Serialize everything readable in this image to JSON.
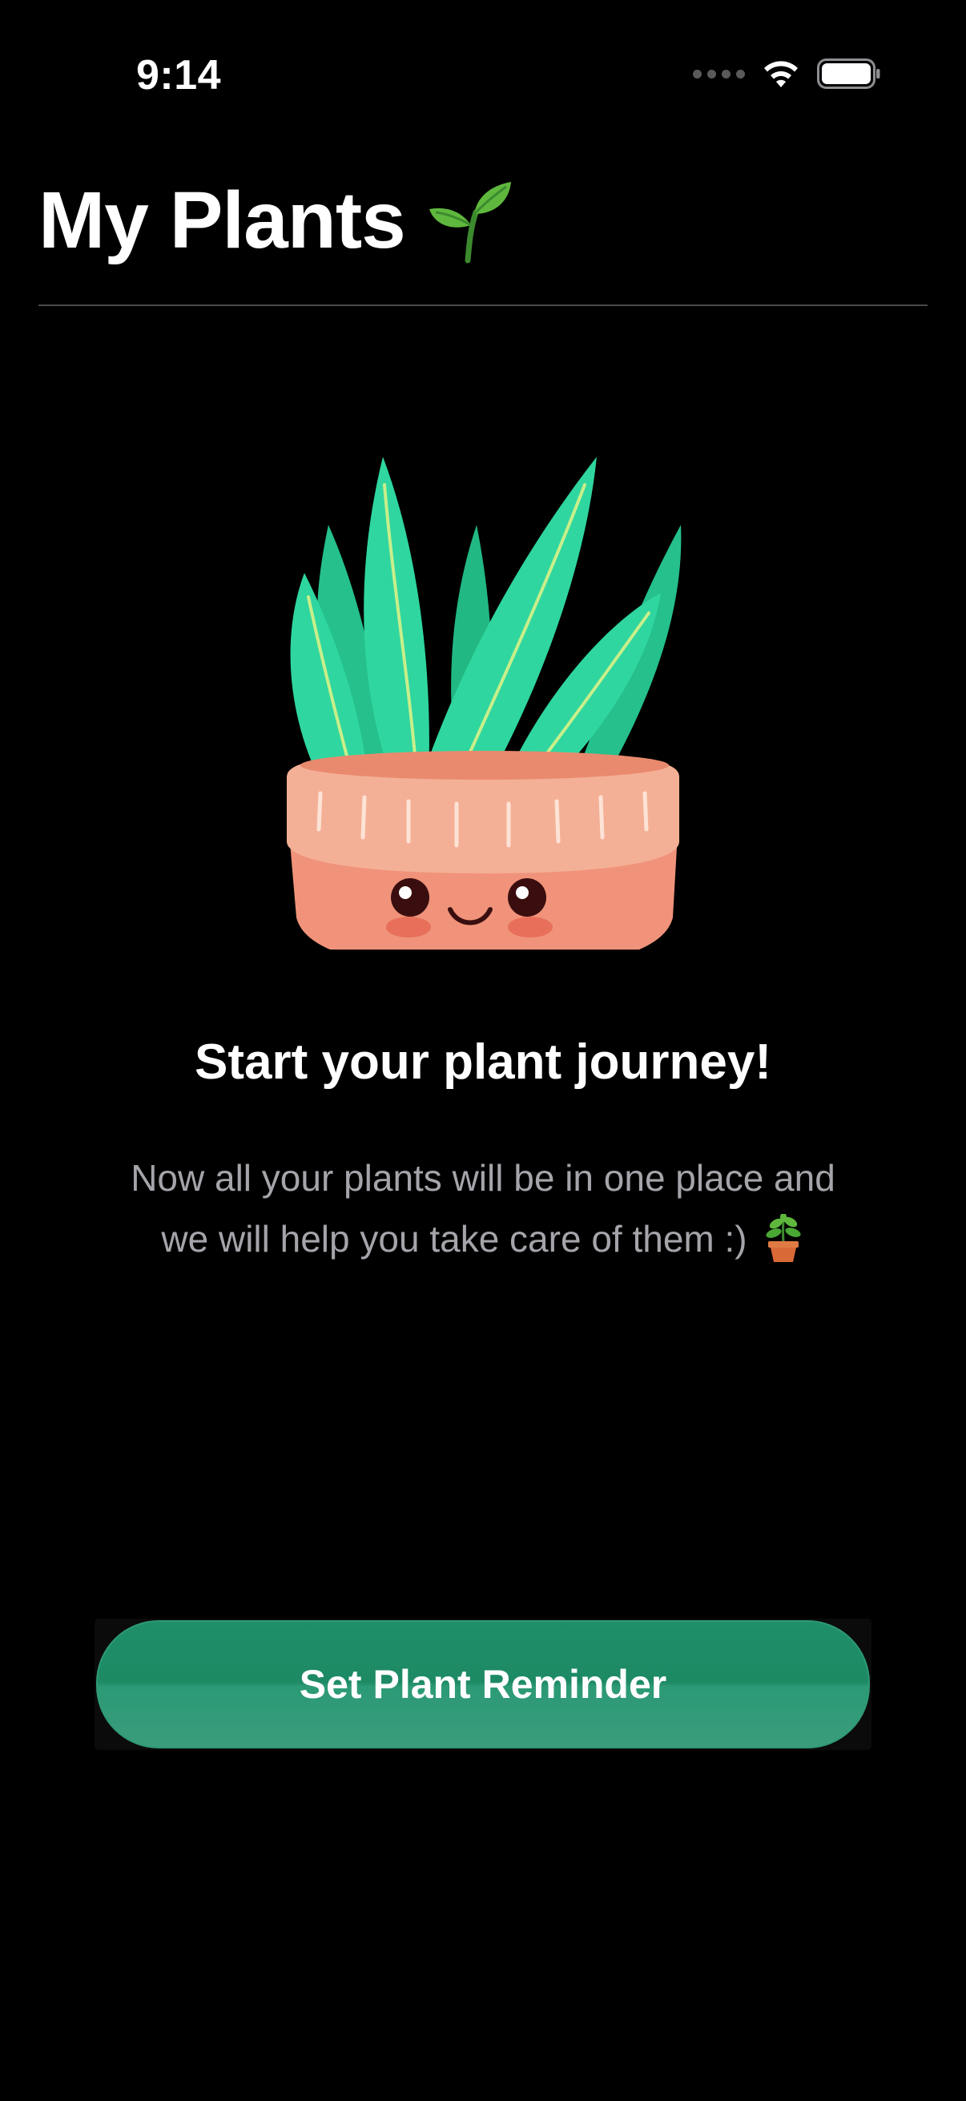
{
  "status_bar": {
    "time": "9:14",
    "icons": [
      "cellular-signal-icon",
      "wifi-icon",
      "battery-icon"
    ]
  },
  "header": {
    "title": "My Plants",
    "title_emoji": "seedling-emoji"
  },
  "empty_state": {
    "illustration": "potted-aloe-plant-illustration",
    "heading": "Start your plant journey!",
    "body_line1": "Now all your plants will be in one place and",
    "body_line2": "we will help you take care of them :)",
    "body_emoji": "potted-plant-emoji"
  },
  "actions": {
    "primary_label": "Set Plant Reminder"
  },
  "colors": {
    "background": "#000000",
    "accent_green": "#1f8f69",
    "secondary_text": "#a4a4aa",
    "pot": "#f0937a",
    "leaves": "#2fd6a0"
  }
}
